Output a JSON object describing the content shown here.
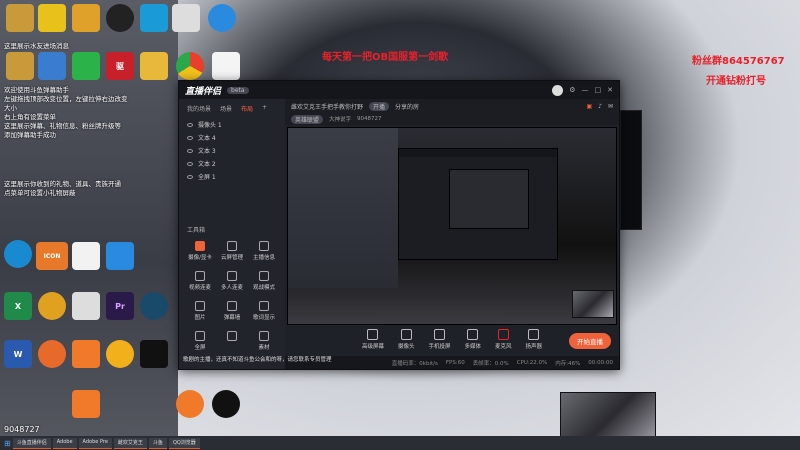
{
  "chat": {
    "line1": "这里展示水友进场消息",
    "line2": "欢迎使用斗鱼弹幕助手",
    "line3": "左键拖拽顶部改变位置，左键拉伸右边改变",
    "line4": "大小",
    "line5": "右上角有设置菜单",
    "line6": "这里展示弹幕、礼物信息、粉丝牌升级等",
    "line7": "添加弹幕助手成功",
    "line8": "这里展示你收到的礼物、道具、贵族开通",
    "line9": "点菜单可设置小礼物屏蔽",
    "user_id": "9048727"
  },
  "overlay": {
    "slogan": "每天第一把OB国服第一剑歌",
    "fan_group": "粉丝群864576767",
    "diamond": "开通钻粉打号"
  },
  "app": {
    "logo": "直播伴侣",
    "version": "beta",
    "room_title": "雌欢艾克王手把手教你打野",
    "room_tag": "开播",
    "share": "分享的房",
    "category": "英雄联盟",
    "area": "大神说字",
    "room_id": "9048727",
    "tabs": [
      "我的场景",
      "场景",
      "布局"
    ],
    "layers": [
      "摄像头 1",
      "文本 4",
      "文本 3",
      "文本 2",
      "全屏 1"
    ],
    "tools_label": "工具箱",
    "tools": [
      "摄像/显卡",
      "云屏管理",
      "主播信息",
      "视频连麦",
      "多人连麦",
      "观战模式",
      "图片",
      "弹幕墙",
      "歌词显示",
      "全屏",
      "",
      "素材"
    ],
    "controls": [
      "高级屏幕",
      "摄像头",
      "手机投屏",
      "多媒体",
      "麦克风",
      "扬声器"
    ],
    "start_btn": "开始直播",
    "status": [
      "直播码率：0kbit/s",
      "FPS:60",
      "丢帧率：0.0%",
      "CPU:22.0%",
      "内存:46%",
      "00:00:00"
    ],
    "notice": "歌剧的主播，还真不知道斗鱼公会和的呀，请您联系专员管理"
  },
  "taskbar": [
    "斗鱼直播伴侣",
    "Adobe",
    "Adobe Pre",
    "雌欢艾克王",
    "斗鱼",
    "QQ浏览器"
  ],
  "colors": {
    "accent": "#f0623a",
    "red": "#e8202a"
  }
}
